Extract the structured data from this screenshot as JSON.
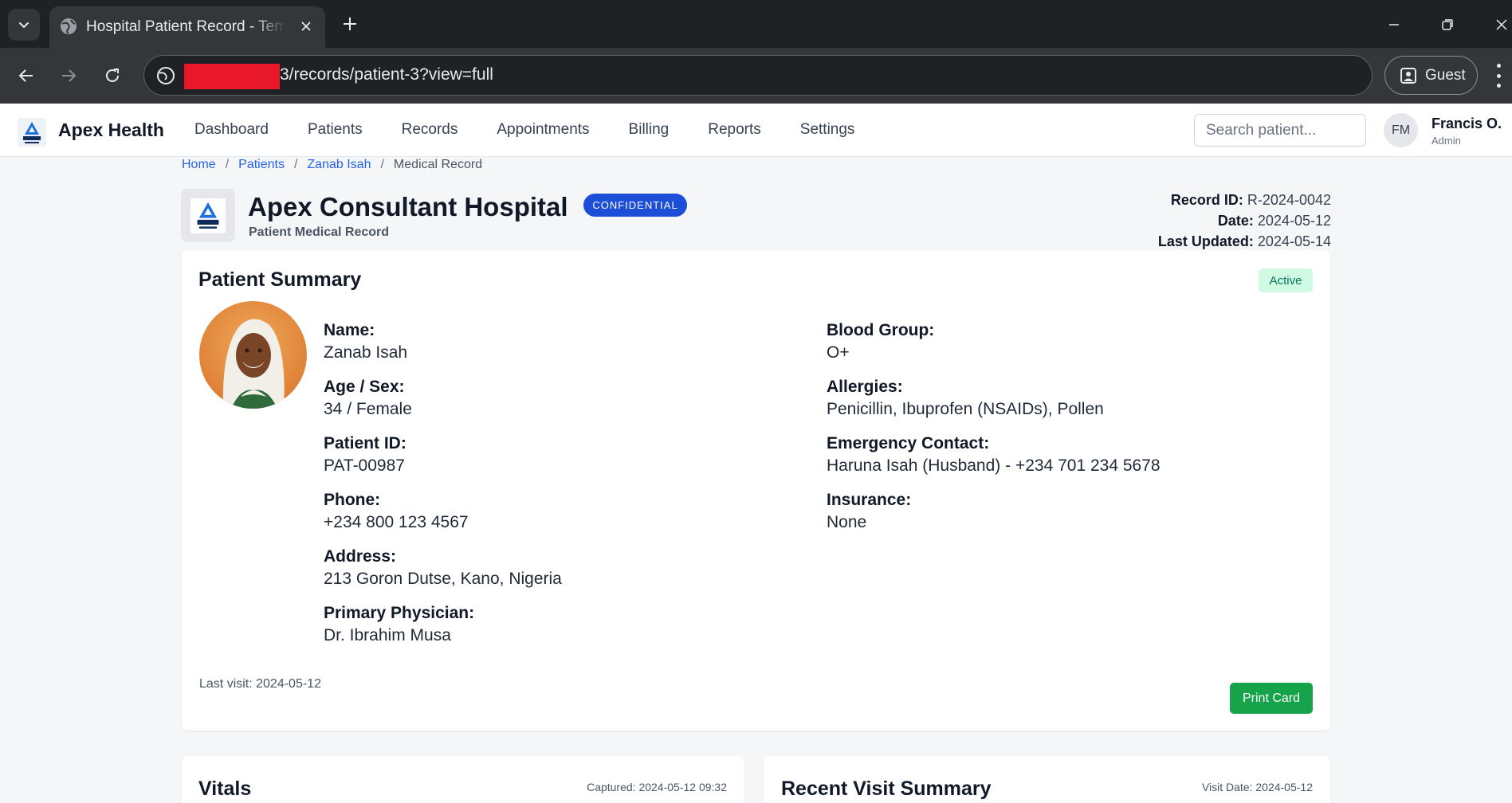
{
  "browser": {
    "tab_title": "Hospital Patient Record - Templ",
    "url_path": "3/records/patient-3?view=full",
    "profile_label": "Guest"
  },
  "app": {
    "brand": "Apex Health",
    "nav": [
      "Dashboard",
      "Patients",
      "Records",
      "Appointments",
      "Billing",
      "Reports",
      "Settings"
    ],
    "search_placeholder": "Search patient...",
    "user": {
      "initials": "FM",
      "name": "Francis O.",
      "role": "Admin"
    }
  },
  "breadcrumb": {
    "items": [
      "Home",
      "Patients",
      "Zanab Isah"
    ],
    "current": "Medical Record",
    "separator": "/"
  },
  "record_header": {
    "hospital": "Apex Consultant Hospital",
    "subtitle": "Patient Medical Record",
    "badge": "CONFIDENTIAL",
    "record_id_label": "Record ID:",
    "record_id": "R-2024-0042",
    "date_label": "Date:",
    "date": "2024-05-12",
    "updated_label": "Last Updated:",
    "updated": "2024-05-14"
  },
  "summary": {
    "title": "Patient Summary",
    "status": "Active",
    "left_fields": [
      {
        "label": "Name:",
        "value": "Zanab Isah"
      },
      {
        "label": "Age / Sex:",
        "value": "34 / Female"
      },
      {
        "label": "Patient ID:",
        "value": "PAT-00987"
      },
      {
        "label": "Phone:",
        "value": "+234 800 123 4567"
      },
      {
        "label": "Address:",
        "value": "213 Goron Dutse, Kano, Nigeria"
      },
      {
        "label": "Primary Physician:",
        "value": "Dr. Ibrahim Musa"
      }
    ],
    "right_fields": [
      {
        "label": "Blood Group:",
        "value": "O+"
      },
      {
        "label": "Allergies:",
        "value": "Penicillin, Ibuprofen (NSAIDs), Pollen"
      },
      {
        "label": "Emergency Contact:",
        "value": "Haruna Isah (Husband) - +234 701 234 5678"
      },
      {
        "label": "Insurance:",
        "value": "None"
      }
    ],
    "last_visit": "Last visit: 2024-05-12",
    "print_button": "Print Card"
  },
  "vitals": {
    "title": "Vitals",
    "captured": "Captured: 2024-05-12 09:32"
  },
  "visit": {
    "title": "Recent Visit Summary",
    "visit_date": "Visit Date: 2024-05-12"
  },
  "colors": {
    "primary": "#1d4ed8",
    "success": "#16a34a",
    "badge_bg": "#d1fae5",
    "link": "#2563eb"
  }
}
